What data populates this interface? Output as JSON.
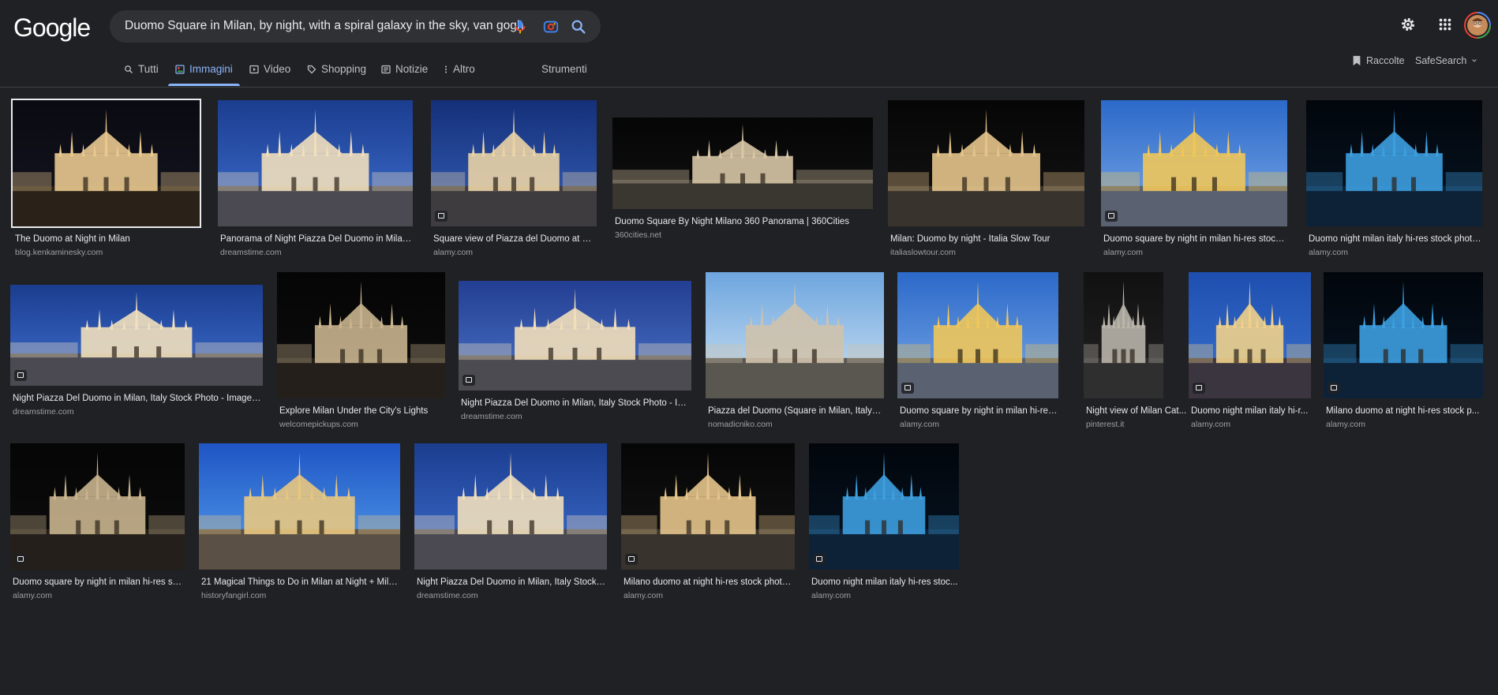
{
  "logo": "Google",
  "search": {
    "query": "Duomo Square in Milan, by night, with a spiral galaxy in the sky, van gogh"
  },
  "tabs": [
    {
      "label": "Tutti",
      "icon": "search-icon"
    },
    {
      "label": "Immagini",
      "icon": "image-icon",
      "active": true
    },
    {
      "label": "Video",
      "icon": "play-icon"
    },
    {
      "label": "Shopping",
      "icon": "tag-icon"
    },
    {
      "label": "Notizie",
      "icon": "news-icon"
    },
    {
      "label": "Altro",
      "icon": "more-vert-icon"
    },
    {
      "label": "Strumenti"
    }
  ],
  "options": {
    "collections": "Raccolte",
    "safesearch": "SafeSearch"
  },
  "colors": {
    "background": "#202124",
    "accent": "#8ab4f8",
    "text": "#e8eaed",
    "muted": "#9aa0a6"
  },
  "results": [
    {
      "title": "The Duomo at Night in Milan",
      "source": "blog.kenkaminesky.com"
    },
    {
      "title": "Panorama of Night Piazza Del Duomo in Milan, I...",
      "source": "dreamstime.com"
    },
    {
      "title": "Square view of Piazza del Duomo at nig...",
      "source": "alamy.com"
    },
    {
      "title": "Duomo Square By Night Milano 360 Panorama | 360Cities",
      "source": "360cities.net"
    },
    {
      "title": "Milan: Duomo by night - Italia Slow Tour",
      "source": "italiaslowtour.com"
    },
    {
      "title": "Duomo square by night in milan hi-res stock ...",
      "source": "alamy.com"
    },
    {
      "title": "Duomo night milan italy hi-res stock photo...",
      "source": "alamy.com"
    },
    {
      "title": "Night Piazza Del Duomo in Milan, Italy Stock Photo - Image of...",
      "source": "dreamstime.com"
    },
    {
      "title": "Explore Milan Under the City's Lights",
      "source": "welcomepickups.com"
    },
    {
      "title": "Night Piazza Del Duomo in Milan, Italy Stock Photo - Ima...",
      "source": "dreamstime.com"
    },
    {
      "title": "Piazza del Duomo (Square in Milan, Italy) -...",
      "source": "nomadicniko.com"
    },
    {
      "title": "Duomo square by night in milan hi-res...",
      "source": "alamy.com"
    },
    {
      "title": "Night view of Milan Cat...",
      "source": "pinterest.it"
    },
    {
      "title": "Duomo night milan italy hi-r...",
      "source": "alamy.com"
    },
    {
      "title": "Milano duomo at night hi-res stock p...",
      "source": "alamy.com"
    },
    {
      "title": "Duomo square by night in milan hi-res sto...",
      "source": "alamy.com"
    },
    {
      "title": "21 Magical Things to Do in Milan at Night + Mila...",
      "source": "historyfangirl.com"
    },
    {
      "title": "Night Piazza Del Duomo in Milan, Italy Stock P...",
      "source": "dreamstime.com"
    },
    {
      "title": "Milano duomo at night hi-res stock photo...",
      "source": "alamy.com"
    },
    {
      "title": "Duomo night milan italy hi-res stoc...",
      "source": "alamy.com"
    }
  ]
}
